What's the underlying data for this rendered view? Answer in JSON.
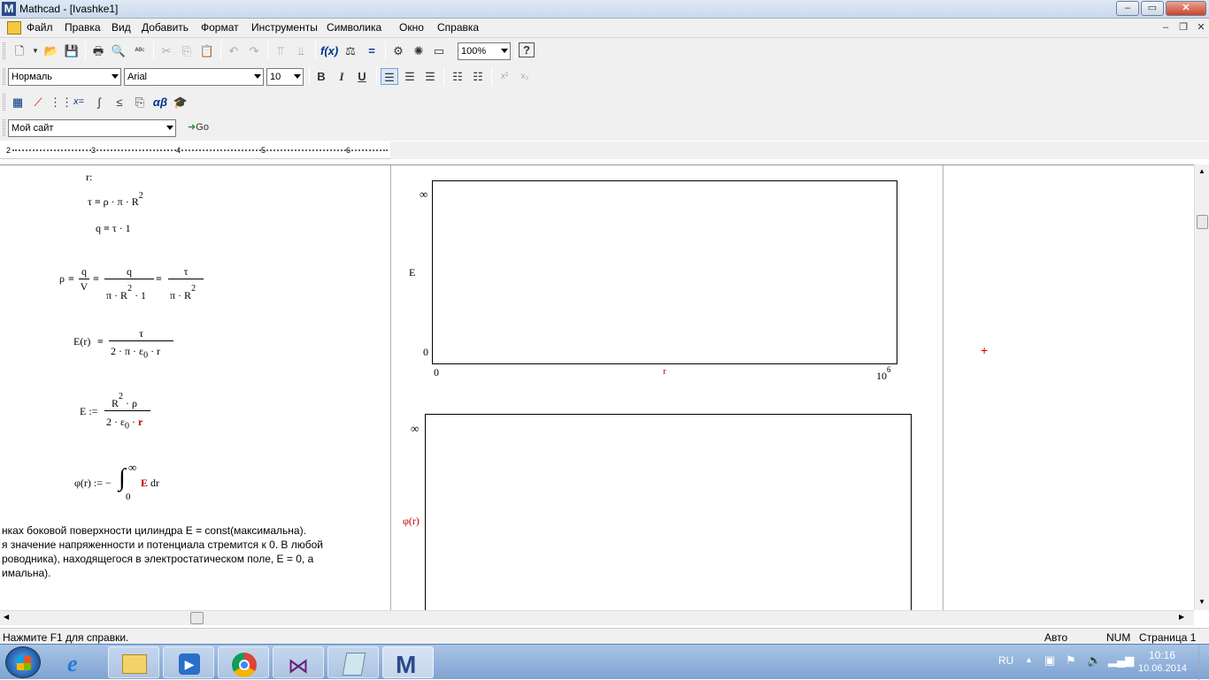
{
  "window": {
    "title": "Mathcad - [Ivashke1]",
    "app_icon": "M"
  },
  "window_buttons": {
    "minimize": "–",
    "maximize": "▭",
    "close": "✕"
  },
  "menu": [
    "Файл",
    "Правка",
    "Вид",
    "Добавить",
    "Формат",
    "Инструменты",
    "Символика",
    "Окно",
    "Справка"
  ],
  "doc_buttons": {
    "minimize": "–",
    "restore": "❐",
    "close": "✕"
  },
  "toolbar_standard": {
    "zoom": "100%"
  },
  "toolbar_format": {
    "style": "Нормаль",
    "font": "Arial",
    "size": "10",
    "bold": "B",
    "italic": "I",
    "underline": "U",
    "superscript": "x²",
    "subscript": "x₂"
  },
  "toolbar_math": {
    "eval_label": "x=",
    "greek_label": "αβ"
  },
  "toolbar_web": {
    "site": "Мой сайт",
    "go": "Go"
  },
  "ruler": {
    "marks": [
      "2",
      "3",
      "4",
      "5",
      "6"
    ]
  },
  "doc": {
    "r_label": "r:",
    "eq_tau": {
      "lhs": "τ",
      "rhs": "ρ · π · R",
      "exp": "2"
    },
    "eq_q": {
      "lhs": "q",
      "rhs": "τ · 1"
    },
    "eq_rho": {
      "lhs": "ρ",
      "f1_num": "q",
      "f1_den": "V",
      "f2_num": "q",
      "f2_den": "π · R",
      "f2_exp": "2",
      "f2_den_tail": "· 1",
      "f3_num": "τ",
      "f3_den": "π · R",
      "f3_exp": "2"
    },
    "eq_E_r": {
      "lhs": "E(r)",
      "num": "τ",
      "den": "2 · π · ε",
      "den_sub": "0",
      "den_tail": "· r"
    },
    "eq_E_def": {
      "lhs": "E :=",
      "num": "R",
      "num_exp": "2",
      "num_tail": "· ρ",
      "den": "2 · ε",
      "den_sub": "0",
      "den_tail": "·",
      "den_red": "r"
    },
    "eq_phi": {
      "lhs": "φ(r) := −",
      "upper": "∞",
      "lower": "0",
      "integrand_red": "E",
      "dr": "dr"
    },
    "text_lines": [
      "нках боковой поверхности цилиндра E = const(максимальна).",
      "я значение напряженности и потенциала стремится к 0. В любой",
      "роводника), находящегося в электростатическом поле,  E = 0, а",
      "имальна)."
    ],
    "plot1": {
      "y_top": "∞",
      "y_label": "E",
      "y_bottom": "0",
      "x_left": "0",
      "x_label": "r",
      "x_right": "10",
      "x_right_exp": "6"
    },
    "plot2": {
      "y_top": "∞",
      "y_label": "φ(r)"
    }
  },
  "status": {
    "help": "Нажмите F1 для справки.",
    "mode": "Авто",
    "num": "NUM",
    "page": "Страница 1"
  },
  "taskbar": {
    "lang": "RU",
    "time": "10:16",
    "date": "10.06.2014"
  },
  "colors": {
    "red": "#c00000",
    "cursor": "#cc0000"
  }
}
